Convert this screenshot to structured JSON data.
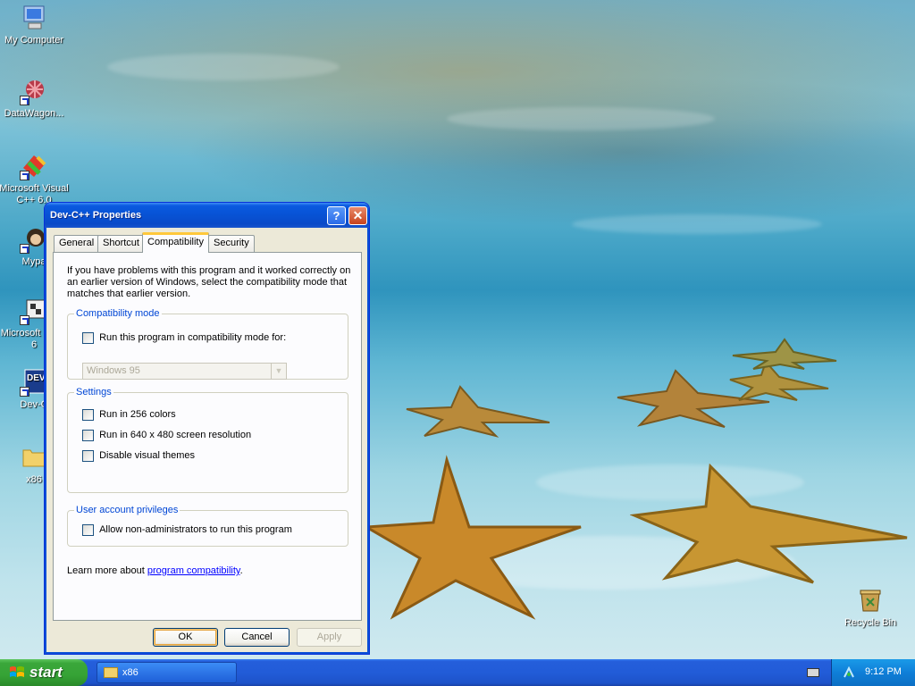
{
  "desktop": {
    "icons": [
      {
        "label": "My Computer"
      },
      {
        "label": "DataWagon..."
      },
      {
        "label": "Microsoft Visual C++ 6.0"
      },
      {
        "label": "Mypa"
      },
      {
        "label": "Microsoft Basic 6"
      },
      {
        "label": "Dev-C"
      },
      {
        "label": "x86"
      },
      {
        "label": "Recycle Bin"
      }
    ]
  },
  "dialog": {
    "title": "Dev-C++ Properties",
    "help_symbol": "?",
    "close_symbol": "✕",
    "tabs": [
      {
        "label": "General"
      },
      {
        "label": "Shortcut"
      },
      {
        "label": "Compatibility",
        "active": true
      },
      {
        "label": "Security"
      }
    ],
    "intro_text": "If you have problems with this program and it worked correctly on an earlier version of Windows, select the compatibility mode that matches that earlier version.",
    "compat_group": {
      "title": "Compatibility mode",
      "checkbox_label": "Run this program in compatibility mode for:",
      "select_value": "Windows 95"
    },
    "settings_group": {
      "title": "Settings",
      "options": [
        {
          "label": "Run in 256 colors"
        },
        {
          "label": "Run in 640 x 480 screen resolution"
        },
        {
          "label": "Disable visual themes"
        }
      ]
    },
    "privileges_group": {
      "title": "User account privileges",
      "checkbox_label": "Allow non-administrators to run this program"
    },
    "learn_prefix": "Learn more about ",
    "learn_link": "program compatibility",
    "learn_suffix": ".",
    "buttons": {
      "ok": "OK",
      "cancel": "Cancel",
      "apply": "Apply"
    }
  },
  "taskbar": {
    "start_label": "start",
    "task_label": "x86",
    "clock": "9:12 PM"
  },
  "colors": {
    "titlebar": "#0752d4",
    "group_title": "#0046d5",
    "tab_highlight": "#ffc83c",
    "start_green": "#36a336",
    "taskbar_blue": "#225cd8"
  }
}
